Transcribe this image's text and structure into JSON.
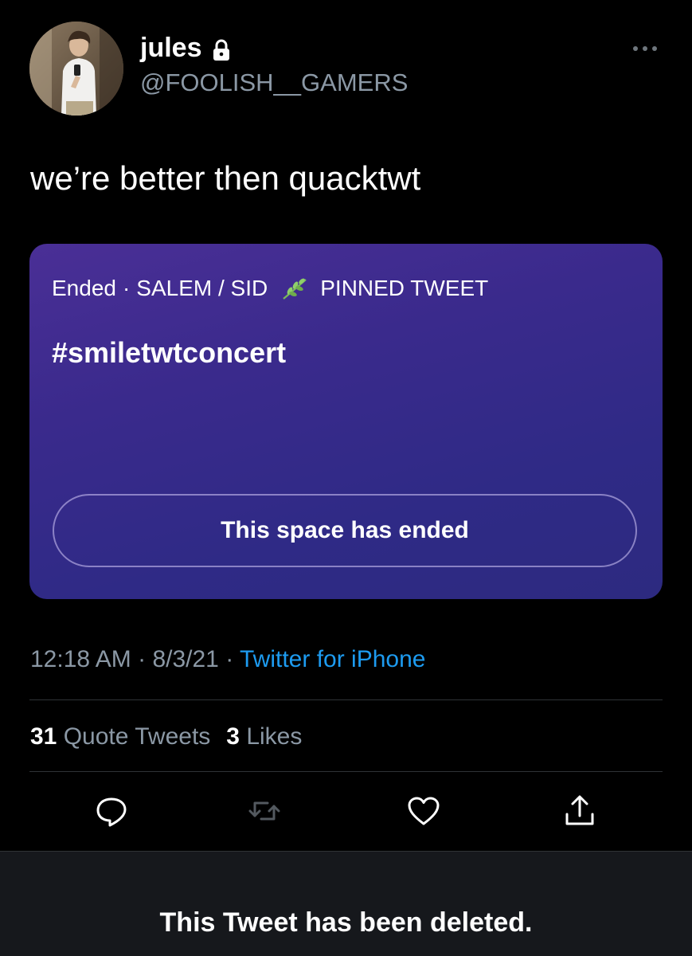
{
  "author": {
    "display_name": "jules",
    "handle": "@FOOLISH__GAMERS",
    "verified_lock_icon": "lock-icon",
    "avatar_icon": "avatar"
  },
  "menu": {
    "icon": "more-horizontal-icon"
  },
  "tweet": {
    "text": "we’re better then quacktwt"
  },
  "space": {
    "status": "Ended",
    "separator": "·",
    "hosts": "SALEM / SID",
    "emoji_icon": "herb-icon",
    "pinned_label": "PINNED TWEET",
    "title": "#smiletwtconcert",
    "ended_button": "This space has ended",
    "colors": {
      "gradient_start": "#4a2f96",
      "gradient_end": "#2d2a80"
    }
  },
  "meta": {
    "time": "12:18 AM",
    "date": "8/3/21",
    "separator": "·",
    "source": "Twitter for iPhone"
  },
  "stats": {
    "quote_count": "31",
    "quote_label": "Quote Tweets",
    "like_count": "3",
    "like_label": "Likes"
  },
  "actions": {
    "reply_icon": "reply-icon",
    "retweet_icon": "retweet-icon",
    "like_icon": "heart-icon",
    "share_icon": "share-icon"
  },
  "banner": {
    "text": "This Tweet has been deleted."
  },
  "colors": {
    "background": "#000000",
    "secondary_text": "#8b98a5",
    "link": "#1d9bf0",
    "divider": "#2f3336"
  }
}
